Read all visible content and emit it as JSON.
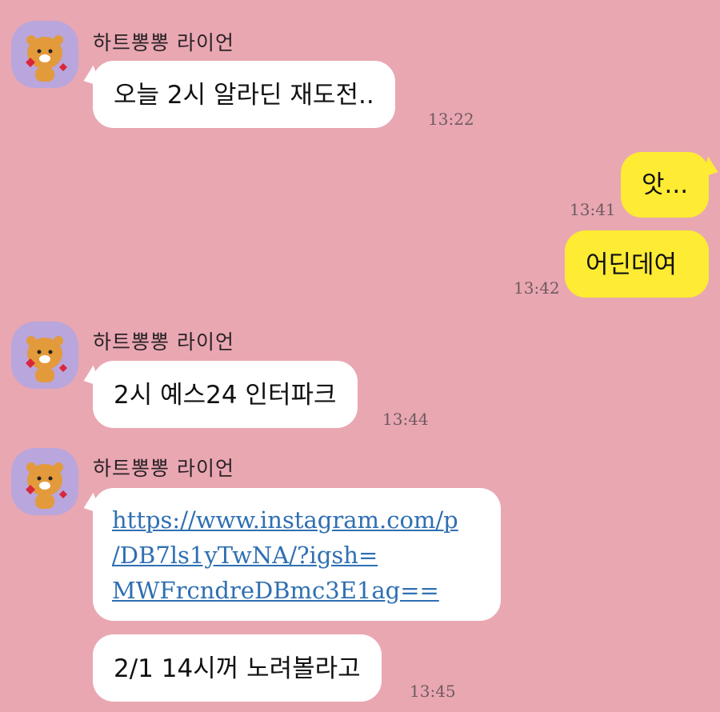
{
  "colors": {
    "background": "#E9A7B2",
    "incoming_bubble": "#FFFFFF",
    "outgoing_bubble": "#FEEB33",
    "link": "#2F6FB2",
    "avatar_bg": "#B9A6DC"
  },
  "avatar_icon": "ryan-lion-heart-icon",
  "groups": {
    "g1": {
      "sender": "하트뽕뽕 라이언",
      "msg1": {
        "text": "오늘 2시 알라딘 재도전..",
        "time": "13:22"
      }
    },
    "g2": {
      "msg1": {
        "text": "앗...",
        "time": "13:41"
      },
      "msg2": {
        "text": "어딘데여",
        "time": "13:42"
      }
    },
    "g3": {
      "sender": "하트뽕뽕 라이언",
      "msg1": {
        "text": "2시 예스24 인터파크",
        "time": "13:44"
      }
    },
    "g4": {
      "sender": "하트뽕뽕 라이언",
      "link": {
        "line1": "https://www.instagram.com/p",
        "line2": "/DB7ls1yTwNA/?igsh=",
        "line3": "MWFrcndreDBmc3E1ag=="
      },
      "msg2": {
        "text": "2/1 14시꺼 노려볼라고",
        "time": "13:45"
      }
    }
  }
}
